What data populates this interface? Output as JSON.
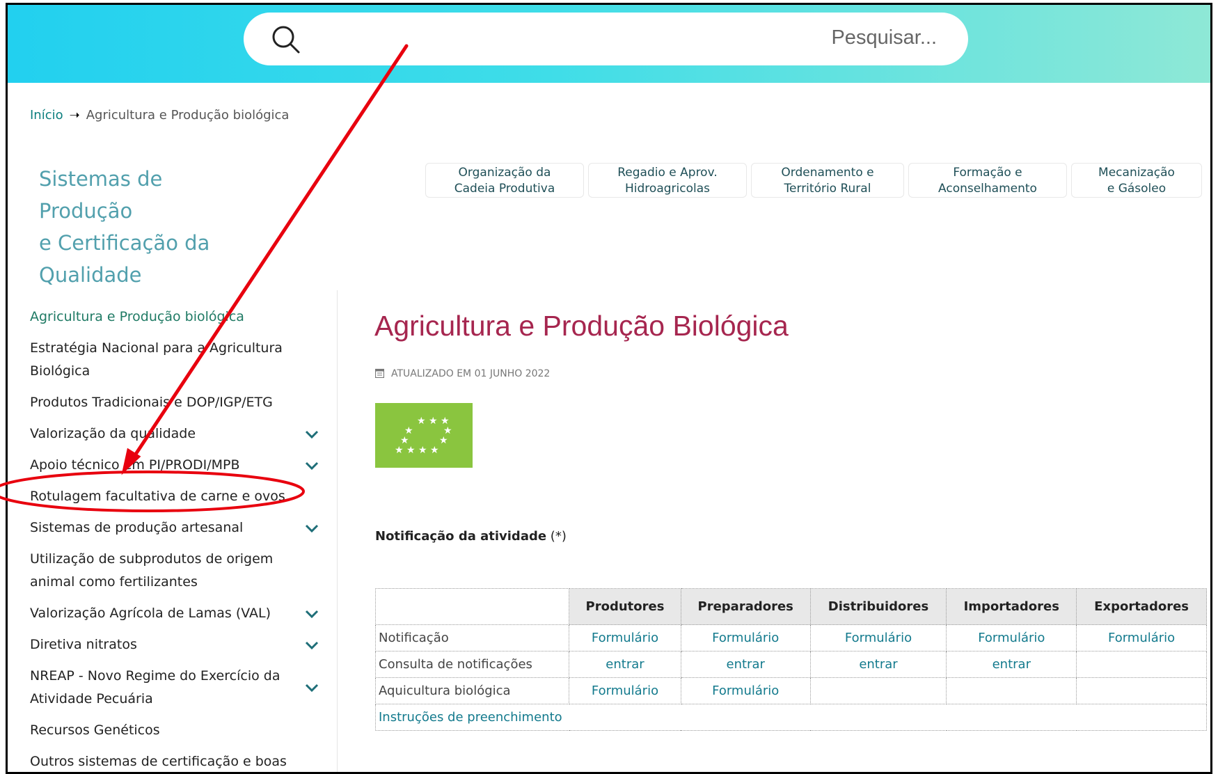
{
  "search": {
    "placeholder": "Pesquisar..."
  },
  "breadcrumb": {
    "home": "Início",
    "current": "Agricultura e Produção biológica"
  },
  "sidebar": {
    "title_lines": [
      "Sistemas de",
      "Produção",
      "e Certificação da",
      "Qualidade"
    ],
    "items": [
      {
        "label": "Agricultura e Produção biológica"
      },
      {
        "label": "Estratégia Nacional para a Agricultura Biológica"
      },
      {
        "label": "Produtos Tradicionais e DOP/IGP/ETG"
      },
      {
        "label": "Valorização da qualidade"
      },
      {
        "label": "Apoio técnico em PI/PRODI/MPB"
      },
      {
        "label": "Rotulagem facultativa de carne e ovos"
      },
      {
        "label": "Sistemas de produção artesanal"
      },
      {
        "label": "Utilização de subprodutos de origem animal como fertilizantes"
      },
      {
        "label": "Valorização Agrícola de Lamas (VAL)"
      },
      {
        "label": "Diretiva nitratos"
      },
      {
        "label": "NREAP - Novo Regime do Exercício da Atividade Pecuária"
      },
      {
        "label": "Recursos Genéticos"
      },
      {
        "label": "Outros sistemas de certificação e boas"
      }
    ]
  },
  "tabs": [
    {
      "line1": "Organização da",
      "line2": "Cadeia Produtiva"
    },
    {
      "line1": "Regadio e Aprov.",
      "line2": "Hidroagricolas"
    },
    {
      "line1": "Ordenamento e",
      "line2": "Território Rural"
    },
    {
      "line1": "Formação e",
      "line2": "Aconselhamento"
    },
    {
      "line1": "Mecanização",
      "line2": "e Gásoleo"
    }
  ],
  "main": {
    "title": "Agricultura e Produção Biológica",
    "updated": "ATUALIZADO EM 01 JUNHO 2022",
    "notif_label": "Notificação da atividade",
    "notif_suffix": "(*)"
  },
  "table": {
    "headers": [
      "Produtores",
      "Preparadores",
      "Distribuidores",
      "Importadores",
      "Exportadores"
    ],
    "rows": [
      {
        "label": "Notificação",
        "cells": [
          "Formulário",
          "Formulário",
          "Formulário",
          "Formulário",
          "Formulário"
        ]
      },
      {
        "label": "Consulta de notificações",
        "cells": [
          "entrar",
          "entrar",
          "entrar",
          "entrar",
          ""
        ]
      },
      {
        "label": "Aquicultura biológica",
        "cells": [
          "Formulário",
          "Formulário",
          "",
          "",
          ""
        ]
      }
    ],
    "instructions": "Instruções de preenchimento"
  },
  "colors": {
    "annotation": "#e8000e",
    "title": "#a6264f",
    "link": "#137a8d",
    "eu_leaf": "#8ac53f"
  }
}
